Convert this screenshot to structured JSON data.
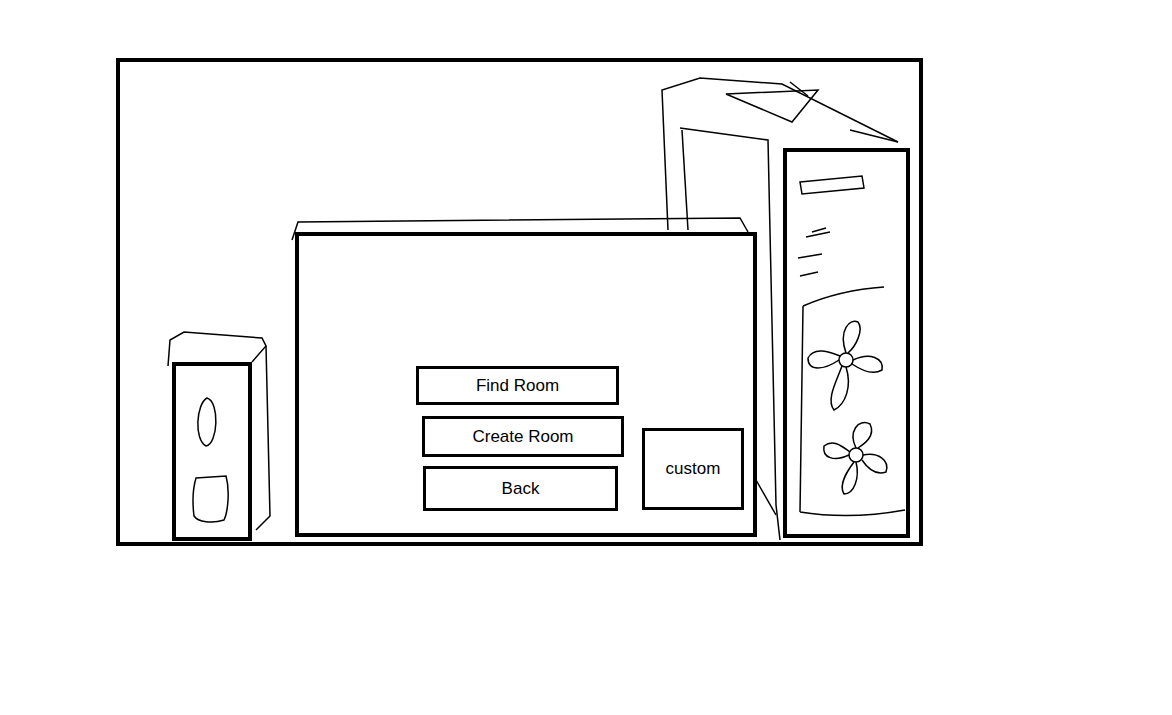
{
  "menu": {
    "buttons": [
      {
        "label": "Find Room"
      },
      {
        "label": "Create Room"
      },
      {
        "label": "Back"
      }
    ],
    "custom": {
      "label": "custom"
    }
  }
}
